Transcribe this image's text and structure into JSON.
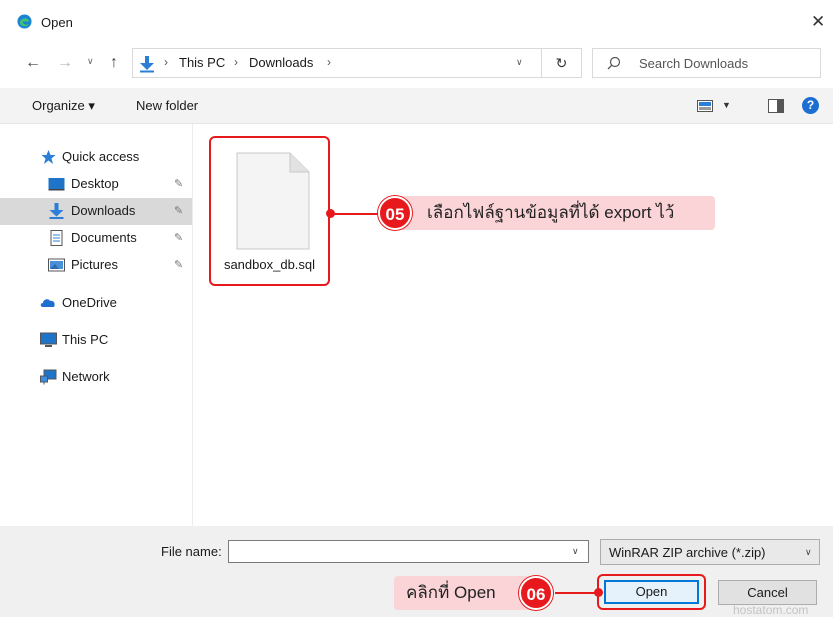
{
  "window": {
    "title": "Open",
    "close_symbol": "✕"
  },
  "nav": {
    "back": "←",
    "forward": "→",
    "recent": "∨",
    "up": "↑",
    "breadcrumb": [
      "This PC",
      "Downloads"
    ],
    "separator": "›",
    "refresh": "↻",
    "search_placeholder": "Search Downloads"
  },
  "commands": {
    "organize": "Organize ▾",
    "new_folder": "New folder",
    "help": "?"
  },
  "sidebar": {
    "items": [
      {
        "label": "Quick access",
        "icon": "star-icon"
      },
      {
        "label": "Desktop",
        "icon": "desktop-icon",
        "pinned": true
      },
      {
        "label": "Downloads",
        "icon": "download-arrow-icon",
        "pinned": true,
        "selected": true
      },
      {
        "label": "Documents",
        "icon": "document-icon",
        "pinned": true
      },
      {
        "label": "Pictures",
        "icon": "pictures-icon",
        "pinned": true
      },
      {
        "label": "OneDrive",
        "icon": "cloud-icon"
      },
      {
        "label": "This PC",
        "icon": "monitor-icon"
      },
      {
        "label": "Network",
        "icon": "network-icon"
      }
    ],
    "pin_symbol": "📌"
  },
  "files": [
    {
      "name": "sandbox_db.sql",
      "icon": "file-icon"
    }
  ],
  "callouts": {
    "step5": {
      "number": "05",
      "text": "เลือกไฟล์ฐานข้อมูลที่ได้ export ไว้"
    },
    "step6": {
      "number": "06",
      "text": "คลิกที่ Open"
    }
  },
  "bottom": {
    "file_name_label": "File name:",
    "file_name_value": "",
    "file_type": "WinRAR ZIP archive (*.zip)",
    "open_label": "Open",
    "cancel_label": "Cancel"
  },
  "watermark": "hostatom.com",
  "colors": {
    "accent": "#0078d7",
    "callout": "#e8191d",
    "callout_bg": "#fad4d6",
    "selected_bg": "#d9d9d9"
  }
}
